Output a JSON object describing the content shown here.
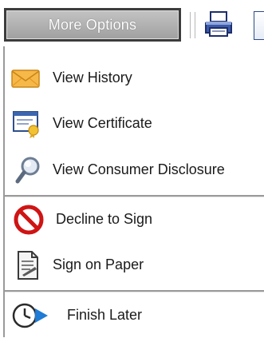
{
  "toolbar": {
    "more_options_label": "More Options",
    "print_icon": "printer-icon"
  },
  "menu": {
    "groups": [
      {
        "items": [
          {
            "label": "View History",
            "icon": "envelope-icon"
          },
          {
            "label": "View Certificate",
            "icon": "certificate-icon"
          },
          {
            "label": "View Consumer Disclosure",
            "icon": "magnifier-icon"
          }
        ]
      },
      {
        "items": [
          {
            "label": "Decline to Sign",
            "icon": "prohibited-icon"
          },
          {
            "label": "Sign on Paper",
            "icon": "document-icon"
          }
        ]
      },
      {
        "items": [
          {
            "label": "Finish Later",
            "icon": "clock-arrow-icon"
          }
        ]
      }
    ]
  },
  "colors": {
    "button_bg": "#b0b0b0",
    "button_border": "#3c3c3c",
    "decline_red": "#d01010",
    "envelope_orange": "#f5a623",
    "arrow_blue": "#1e7bd6"
  }
}
